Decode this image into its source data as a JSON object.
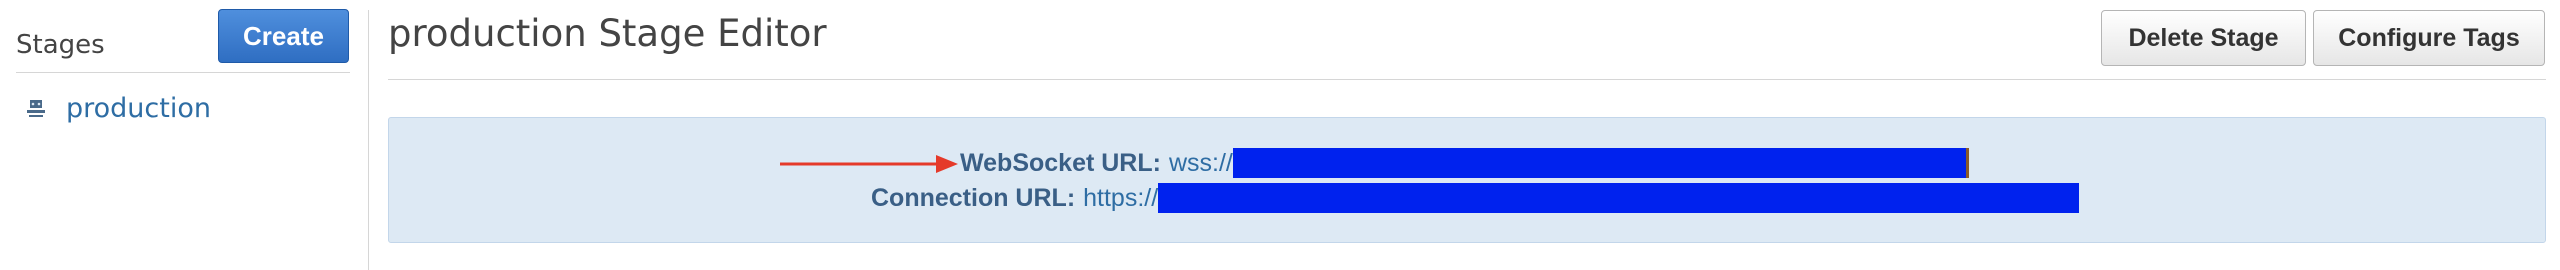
{
  "sidebar": {
    "title": "Stages",
    "create_label": "Create",
    "items": [
      {
        "label": "production",
        "icon": "stage-icon"
      }
    ]
  },
  "header": {
    "title": "production Stage Editor",
    "delete_label": "Delete Stage",
    "configure_tags_label": "Configure Tags"
  },
  "info": {
    "websocket_label": "WebSocket URL:",
    "websocket_value": "wss://",
    "connection_label": "Connection URL:",
    "connection_value": "https://"
  },
  "colors": {
    "primary_button": "#2f6ec2",
    "link": "#2e6da4",
    "info_background": "#dde9f4",
    "redaction": "#0022ee",
    "annotation_arrow": "#e53a2a"
  }
}
